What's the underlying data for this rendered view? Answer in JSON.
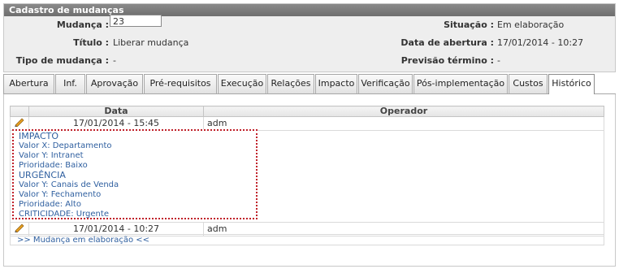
{
  "panel": {
    "title": "Cadastro de mudanças",
    "mudanca_label": "Mudança :",
    "mudanca_value": "23",
    "titulo_label": "Título :",
    "titulo_value": "Liberar mudança",
    "tipo_label": "Tipo de mudança :",
    "tipo_value": "-",
    "situacao_label": "Situação :",
    "situacao_value": "Em elaboração",
    "abertura_label": "Data de abertura :",
    "abertura_value": "17/01/2014 - 10:27",
    "previsao_label": "Previsão término :",
    "previsao_value": "-"
  },
  "tabs": [
    "Abertura",
    "Inf.",
    "Aprovação",
    "Pré-requisitos",
    "Execução",
    "Relações",
    "Impacto",
    "Verificação",
    "Pós-implementação",
    "Custos",
    "Histórico"
  ],
  "active_tab": "Histórico",
  "history": {
    "columns": [
      "Data",
      "Operador"
    ],
    "rows": [
      {
        "date": "17/01/2014 - 15:45",
        "operator": "adm",
        "icon": "pencil-icon"
      },
      {
        "date": "17/01/2014 - 10:27",
        "operator": "adm",
        "icon": "pencil-icon"
      }
    ],
    "details": [
      "IMPACTO",
      "Valor X: Departamento",
      "Valor Y: Intranet",
      "Prioridade: Baixo",
      "URGÊNCIA",
      "Valor Y: Canais de Venda",
      "Valor Y: Fechamento",
      "Prioridade: Alto",
      "CRITICIDADE: Urgente"
    ],
    "footer": ">> Mudança em elaboração <<"
  },
  "colors": {
    "header": "#7a7a7a",
    "highlight_border": "#c0202a",
    "detail_text": "#3060a0"
  }
}
